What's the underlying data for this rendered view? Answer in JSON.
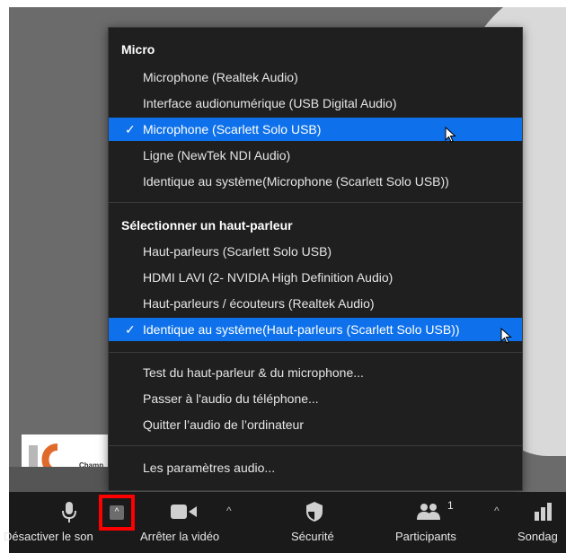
{
  "menu": {
    "micro_header": "Micro",
    "mic_items": [
      {
        "label": "Microphone (Realtek Audio)",
        "selected": false
      },
      {
        "label": "Interface audionumérique (USB Digital Audio)",
        "selected": false
      },
      {
        "label": "Microphone (Scarlett Solo USB)",
        "selected": true
      },
      {
        "label": "Ligne (NewTek NDI Audio)",
        "selected": false
      },
      {
        "label": "Identique au système(Microphone (Scarlett Solo USB))",
        "selected": false
      }
    ],
    "speaker_header": "Sélectionner un haut-parleur",
    "speaker_items": [
      {
        "label": "Haut-parleurs (Scarlett Solo USB)",
        "selected": false
      },
      {
        "label": "HDMI LAVI (2- NVIDIA High Definition Audio)",
        "selected": false
      },
      {
        "label": "Haut-parleurs / écouteurs (Realtek Audio)",
        "selected": false
      },
      {
        "label": "Identique au système(Haut-parleurs (Scarlett Solo USB))",
        "selected": true
      }
    ],
    "actions": [
      "Test du haut-parleur & du microphone...",
      "Passer à l'audio du téléphone...",
      "Quitter l’audio de l’ordinateur"
    ],
    "settings": "Les paramètres audio..."
  },
  "toolbar": {
    "mute_label": "Désactiver le son",
    "video_label": "Arrêter la vidéo",
    "security_label": "Sécurité",
    "participants_label": "Participants",
    "participants_count": "1",
    "poll_label": "Sondag"
  },
  "logo": {
    "text": "Champ"
  },
  "colors": {
    "accent": "#0e71eb",
    "menu_bg": "#1f1f1f",
    "toolbar_bg": "#1a1a1a",
    "highlight": "#ff0000"
  }
}
